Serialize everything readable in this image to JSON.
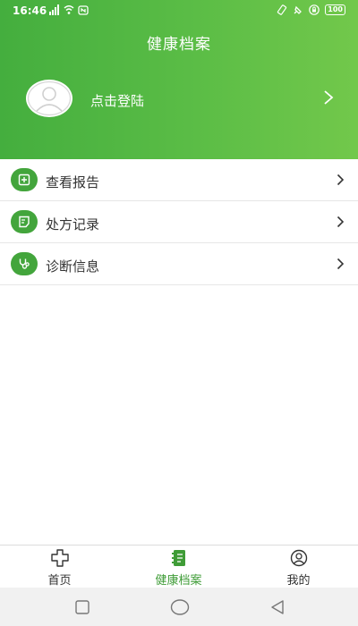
{
  "status_bar": {
    "time": "16:46",
    "battery": "100",
    "left_icons": [
      "signal-icon",
      "wifi-icon",
      "nfc-icon"
    ],
    "right_icons": [
      "vibrate-icon",
      "alarm-icon",
      "lock-icon"
    ]
  },
  "header": {
    "title": "健康档案",
    "login_text": "点击登陆",
    "background_color": "#5bbd46"
  },
  "menu": {
    "items": [
      {
        "label": "查看报告",
        "icon": "report-icon"
      },
      {
        "label": "处方记录",
        "icon": "prescription-icon"
      },
      {
        "label": "诊断信息",
        "icon": "stethoscope-icon"
      }
    ],
    "icon_color": "#43a53c"
  },
  "tabbar": {
    "tabs": [
      {
        "label": "首页",
        "icon": "home-cross-icon",
        "active": false
      },
      {
        "label": "健康档案",
        "icon": "notebook-icon",
        "active": true
      },
      {
        "label": "我的",
        "icon": "profile-icon",
        "active": false
      }
    ],
    "active_color": "#3f9c37"
  },
  "system_nav": {
    "buttons": [
      "square-icon",
      "circle-icon",
      "back-triangle-icon"
    ]
  }
}
